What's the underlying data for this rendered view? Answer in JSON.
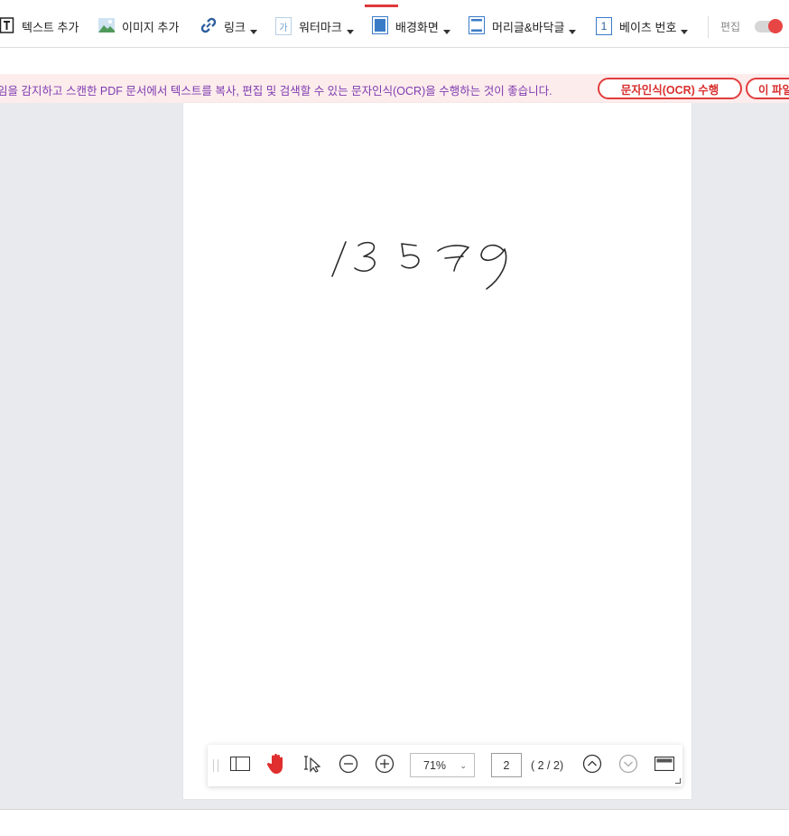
{
  "toolbar": {
    "items": [
      {
        "label": "텍스트 추가",
        "icon": "text-add-icon"
      },
      {
        "label": "이미지 추가",
        "icon": "image-add-icon"
      },
      {
        "label": "링크",
        "icon": "link-icon"
      },
      {
        "label": "워터마크",
        "icon": "watermark-icon",
        "icon_text": "가"
      },
      {
        "label": "배경화면",
        "icon": "background-icon"
      },
      {
        "label": "머리글&바닥글",
        "icon": "header-footer-icon"
      },
      {
        "label": "베이츠 번호",
        "icon": "bates-number-icon",
        "icon_text": "1"
      }
    ],
    "edit_label": "편집",
    "edit_toggle_on": true,
    "accent_color": "#e0393b"
  },
  "notice": {
    "text": "임을 감지하고 스캔한 PDF 문서에서 텍스트를 복사, 편집 및 검색할 수 있는 문자인식(OCR)을 수행하는 것이 좋습니다.",
    "ocr_button": "문자인식(OCR) 수행",
    "second_button": "이 파일",
    "text_color": "#7d3bb0",
    "background": "#fdecec"
  },
  "document": {
    "handwritten_content": "13579"
  },
  "navbar": {
    "zoom": "71%",
    "current_page": "2",
    "page_count": "( 2 / 2)"
  }
}
